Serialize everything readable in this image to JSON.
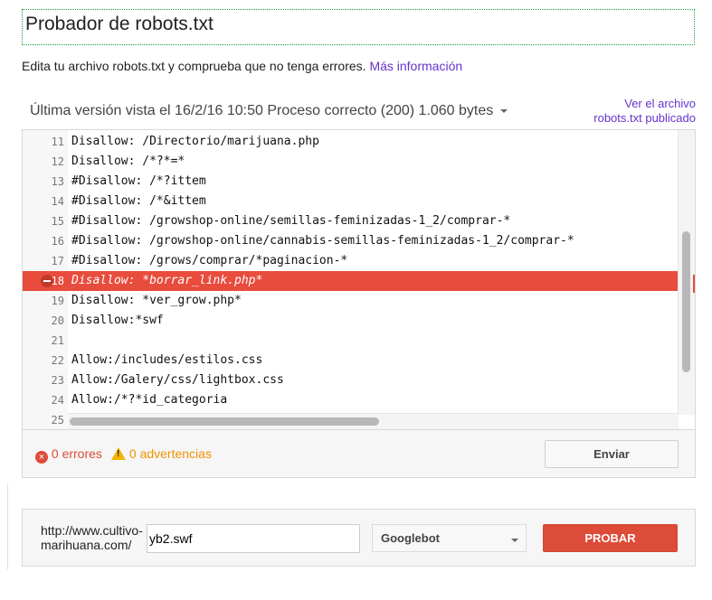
{
  "header": {
    "title": "Probador de robots.txt",
    "subtitle": "Edita tu archivo robots.txt y comprueba que no tenga errores.",
    "more_info_link": "Más información"
  },
  "version": {
    "label": "Última versión vista el 16/2/16 10:50 Proceso correcto (200) 1.060 bytes",
    "view_link_line1": "Ver el archivo",
    "view_link_line2": "robots.txt publicado"
  },
  "editor": {
    "lines": [
      {
        "num": "11",
        "text": "Disallow: /Directorio/marijuana.php"
      },
      {
        "num": "12",
        "text": "Disallow: /*?*=*"
      },
      {
        "num": "13",
        "text": "#Disallow: /*?ittem"
      },
      {
        "num": "14",
        "text": "#Disallow: /*&ittem"
      },
      {
        "num": "15",
        "text": "#Disallow: /growshop-online/semillas-feminizadas-1_2/comprar-*"
      },
      {
        "num": "16",
        "text": "#Disallow: /growshop-online/cannabis-semillas-feminizadas-1_2/comprar-*"
      },
      {
        "num": "17",
        "text": "#Disallow: /grows/comprar/*paginacion-*"
      },
      {
        "num": "18",
        "text": "Disallow: *borrar_link.php*",
        "error": true
      },
      {
        "num": "19",
        "text": "Disallow: *ver_grow.php*"
      },
      {
        "num": "20",
        "text": "Disallow:*swf"
      },
      {
        "num": "21",
        "text": ""
      },
      {
        "num": "22",
        "text": "Allow:/includes/estilos.css"
      },
      {
        "num": "23",
        "text": "Allow:/Galery/css/lightbox.css"
      },
      {
        "num": "24",
        "text": "Allow:/*?*id_categoria"
      },
      {
        "num": "25",
        "text": ""
      }
    ]
  },
  "status": {
    "errors": "0 errores",
    "warnings": "0 advertencias",
    "send_label": "Enviar"
  },
  "tester": {
    "base_url_line1": "http://www.cultivo-",
    "base_url_line2": "marihuana.com/",
    "url_value": "yb2.swf",
    "user_agent": "Googlebot",
    "test_label": "PROBAR"
  },
  "colors": {
    "error_red": "#e84c3d",
    "link_purple": "#6633cc",
    "warning_orange": "#f09300",
    "title_border_green": "#1e9e3e"
  },
  "icons": [
    "error-circle-icon",
    "x-circle-icon",
    "warning-triangle-icon",
    "dropdown-caret-icon"
  ]
}
